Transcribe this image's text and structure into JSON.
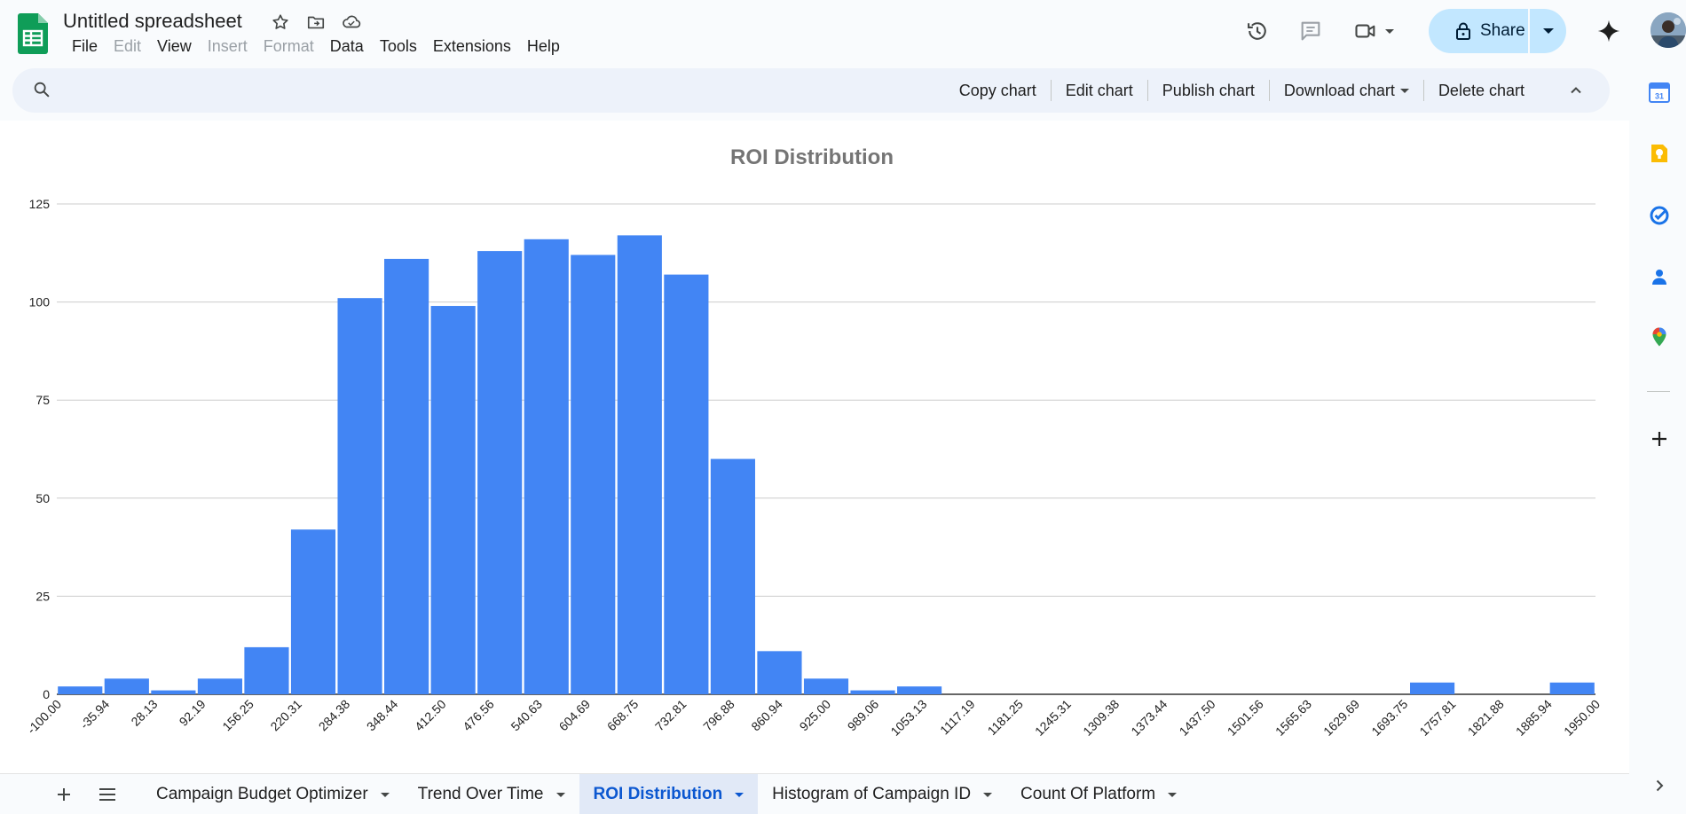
{
  "doc": {
    "title": "Untitled spreadsheet"
  },
  "menu": [
    "File",
    "Edit",
    "View",
    "Insert",
    "Format",
    "Data",
    "Tools",
    "Extensions",
    "Help"
  ],
  "menu_disabled": [
    "Edit",
    "Insert",
    "Format"
  ],
  "header": {
    "share_label": "Share"
  },
  "chart_toolbar": {
    "copy": "Copy chart",
    "edit": "Edit chart",
    "publish": "Publish chart",
    "download": "Download chart",
    "delete": "Delete chart"
  },
  "sheets": {
    "tabs": [
      "Campaign Budget Optimizer",
      "Trend Over Time",
      "ROI Distribution",
      "Histogram of Campaign ID",
      "Count Of Platform"
    ],
    "active": "ROI Distribution"
  },
  "colors": {
    "bar": "#4285f4",
    "accent": "#0b57d0",
    "share_bg": "#c2e7ff",
    "sheets_green": "#0f9d58"
  },
  "chart_data": {
    "type": "bar",
    "title": "ROI Distribution",
    "xlabel": "",
    "ylabel": "",
    "ylim": [
      0,
      125
    ],
    "yticks": [
      "0",
      "25",
      "50",
      "75",
      "100",
      "125"
    ],
    "grid": true,
    "x_tick_labels": [
      "-100.00",
      "-35.94",
      "28.13",
      "92.19",
      "156.25",
      "220.31",
      "284.38",
      "348.44",
      "412.50",
      "476.56",
      "540.63",
      "604.69",
      "668.75",
      "732.81",
      "796.88",
      "860.94",
      "925.00",
      "989.06",
      "1053.13",
      "1117.19",
      "1181.25",
      "1245.31",
      "1309.38",
      "1373.44",
      "1437.50",
      "1501.56",
      "1565.63",
      "1629.69",
      "1693.75",
      "1757.81",
      "1821.88",
      "1885.94",
      "1950.00"
    ],
    "values": [
      2,
      4,
      1,
      4,
      12,
      42,
      101,
      111,
      99,
      113,
      116,
      112,
      117,
      107,
      60,
      11,
      4,
      1,
      2,
      0,
      0,
      0,
      0,
      0,
      0,
      0,
      0,
      0,
      0,
      3,
      0,
      0,
      3
    ]
  }
}
